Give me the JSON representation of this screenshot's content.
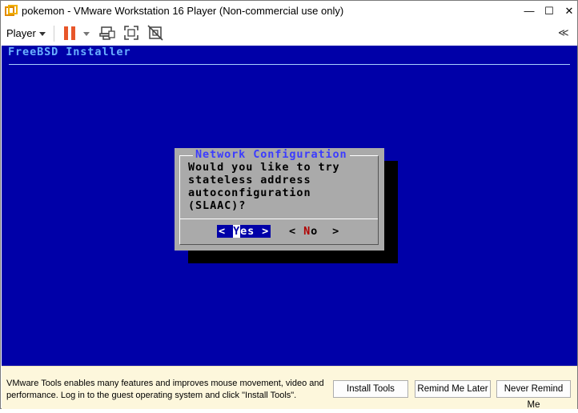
{
  "window": {
    "title": "pokemon - VMware Workstation 16 Player (Non-commercial use only)",
    "minimize": "—",
    "maximize": "☐",
    "close": "✕"
  },
  "toolbar": {
    "player_menu": "Player",
    "collapse": "≪",
    "icons": [
      "pause-icon",
      "send-ctrl-alt-del-icon",
      "fit-guest-icon",
      "unity-icon"
    ]
  },
  "guest": {
    "header": "FreeBSD Installer",
    "dialog": {
      "title": "Network Configuration",
      "message": "Would you like to try\nstateless address\nautoconfiguration\n(SLAAC)?",
      "yes_pre": "< ",
      "yes_hotkey": "Y",
      "yes_post": "es >",
      "no_pre": "< ",
      "no_hotkey": "N",
      "no_post": "o  >"
    }
  },
  "notification": {
    "message": "VMware Tools enables many features and improves mouse movement, video and performance. Log in to the guest operating system and click \"Install Tools\".",
    "install_tools": "Install Tools",
    "remind_later": "Remind Me Later",
    "never_remind": "Never Remind Me"
  },
  "colors": {
    "guest_background": "#0000a8",
    "pause_accent": "#e8562a",
    "notification_bg": "#fdf7dc"
  }
}
